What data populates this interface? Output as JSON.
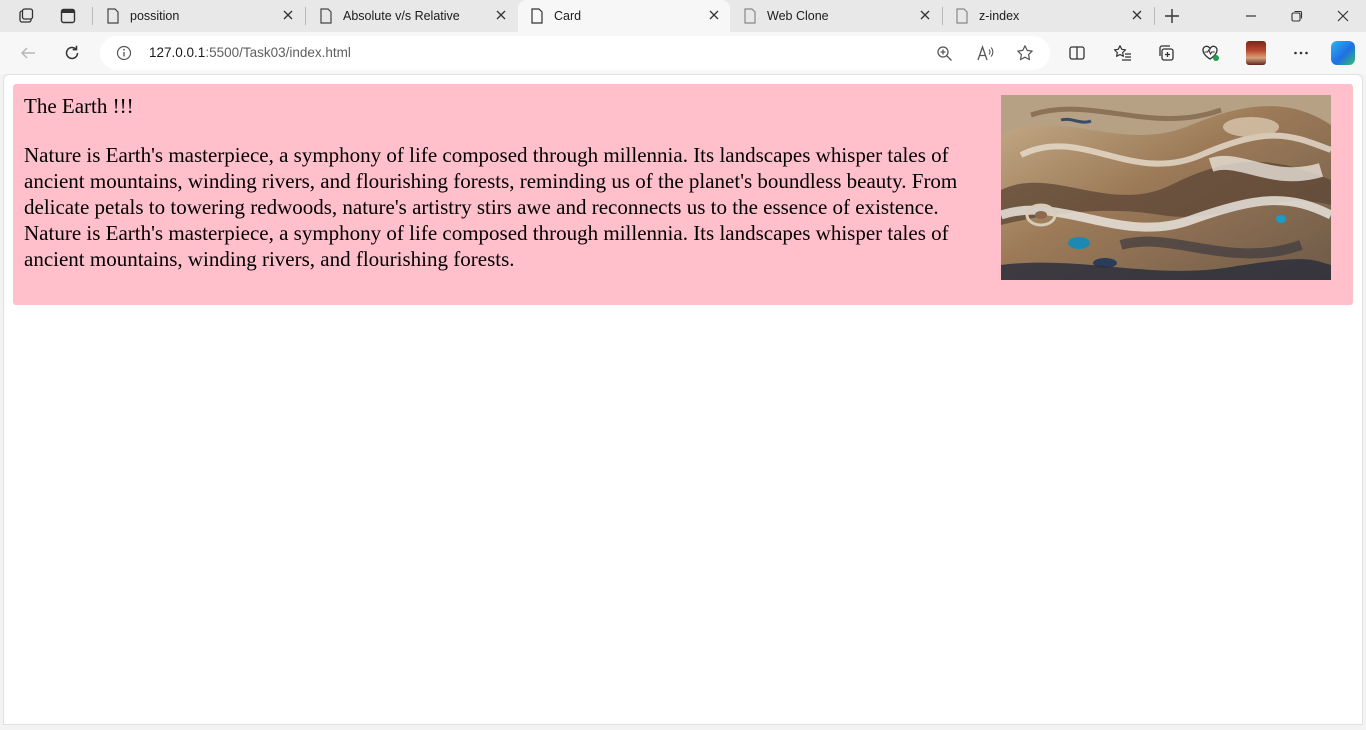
{
  "window": {
    "tabs": [
      {
        "label": "possition",
        "active": false
      },
      {
        "label": "Absolute v/s Relative",
        "active": false
      },
      {
        "label": "Card",
        "active": true
      },
      {
        "label": "Web Clone",
        "active": false
      },
      {
        "label": "z-index",
        "active": false
      }
    ]
  },
  "toolbar": {
    "url_host": "127.0.0.1",
    "url_rest": ":5500/Task03/index.html"
  },
  "page": {
    "card": {
      "title": "The Earth !!!",
      "text": "Nature is Earth's masterpiece, a symphony of life composed through millennia. Its landscapes whisper tales of ancient mountains, winding rivers, and flourishing forests, reminding us of the planet's boundless beauty. From delicate petals to towering redwoods, nature's artistry stirs awe and reconnects us to the essence of existence. Nature is Earth's masterpiece, a symphony of life composed through millennia. Its landscapes whisper tales of ancient mountains, winding rivers, and flourishing forests.",
      "background": "#ffc0cb"
    }
  }
}
